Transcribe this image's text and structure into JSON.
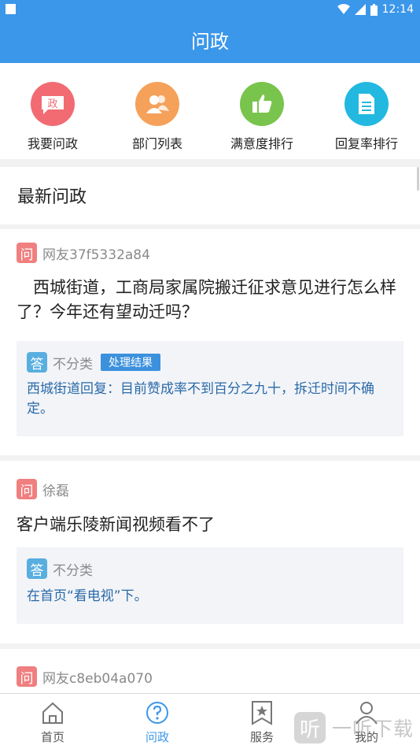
{
  "status_bar": {
    "time": "12:14",
    "battery": "▮"
  },
  "app_bar": {
    "title": "问政"
  },
  "quick_actions": [
    {
      "label": "我要问政",
      "icon": "ask-icon",
      "color": "#f26b72",
      "glyph": "政"
    },
    {
      "label": "部门列表",
      "icon": "people-icon",
      "color": "#f5a15a"
    },
    {
      "label": "满意度排行",
      "icon": "thumbs-up-icon",
      "color": "#79c44c"
    },
    {
      "label": "回复率排行",
      "icon": "document-icon",
      "color": "#22b8e0"
    }
  ],
  "section": {
    "title": "最新问政"
  },
  "posts": [
    {
      "q_badge": "问",
      "asker": "网友37f5332a84",
      "question": "　西城街道，工商局家属院搬迁征求意见进行怎么样了？今年还有望动迁吗？",
      "a_badge": "答",
      "category": "不分类",
      "tag": "处理结果",
      "answer": "西城街道回复：目前赞成率不到百分之九十，拆迁时间不确定。"
    },
    {
      "q_badge": "问",
      "asker": "徐磊",
      "question": "客户端乐陵新闻视频看不了",
      "a_badge": "答",
      "category": "不分类",
      "answer": "在首页“看电视”下。"
    },
    {
      "q_badge": "问",
      "asker": "网友c8eb04a070"
    }
  ],
  "tab_bar": [
    {
      "label": "首页",
      "icon": "home-icon"
    },
    {
      "label": "问政",
      "icon": "question-circle-icon",
      "active": true
    },
    {
      "label": "服务",
      "icon": "star-bookmark-icon"
    },
    {
      "label": "我的",
      "icon": "person-icon"
    }
  ],
  "watermark": {
    "glyph": "听",
    "text": "一听下载"
  },
  "colors": {
    "primary": "#3b97ea",
    "ask_badge": "#f07f80",
    "answer_badge": "#59aee0",
    "answer_text": "#2a6aa8"
  }
}
